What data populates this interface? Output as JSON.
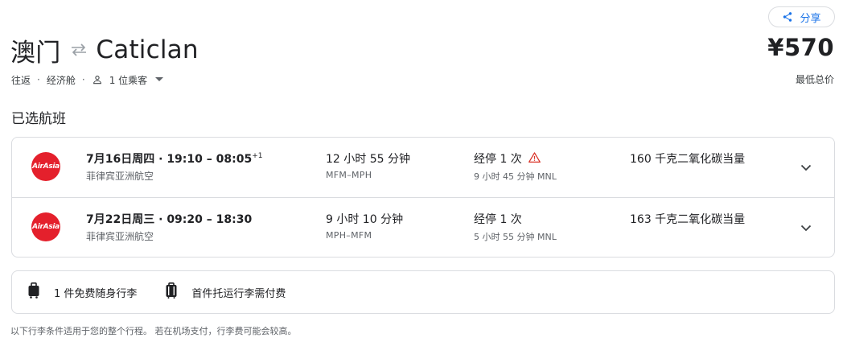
{
  "header": {
    "share_label": "分享",
    "origin": "澳门",
    "destination": "Caticlan",
    "price": "¥570",
    "price_label": "最低总价"
  },
  "trip": {
    "type": "往返",
    "cabin": "经济舱",
    "passengers": "1 位乘客"
  },
  "section_title": "已选航班",
  "flights": [
    {
      "date": "7月16日周四",
      "times": "19:10 – 08:05",
      "day_offset": "+1",
      "airline": "菲律宾亚洲航空",
      "airline_logo_text": "AirAsia",
      "duration": "12 小时 55 分钟",
      "airports": "MFM–MPH",
      "stops": "经停 1 次",
      "warning": true,
      "layover": "9 小时 45 分钟 MNL",
      "emissions": "160 千克二氧化碳当量"
    },
    {
      "date": "7月22日周三",
      "times": "09:20 – 18:30",
      "day_offset": "",
      "airline": "菲律宾亚洲航空",
      "airline_logo_text": "AirAsia",
      "duration": "9 小时 10 分钟",
      "airports": "MPH–MFM",
      "stops": "经停 1 次",
      "warning": false,
      "layover": "5 小时 55 分钟 MNL",
      "emissions": "163 千克二氧化碳当量"
    }
  ],
  "baggage": {
    "carry_on": "1 件免费随身行李",
    "checked": "首件托运行李需付费"
  },
  "footnote": "以下行李条件适用于您的整个行程。 若在机场支付，行李费可能会较高。",
  "colors": {
    "accent": "#1a73e8",
    "airline_red": "#e4202c",
    "warning": "#d93025"
  }
}
